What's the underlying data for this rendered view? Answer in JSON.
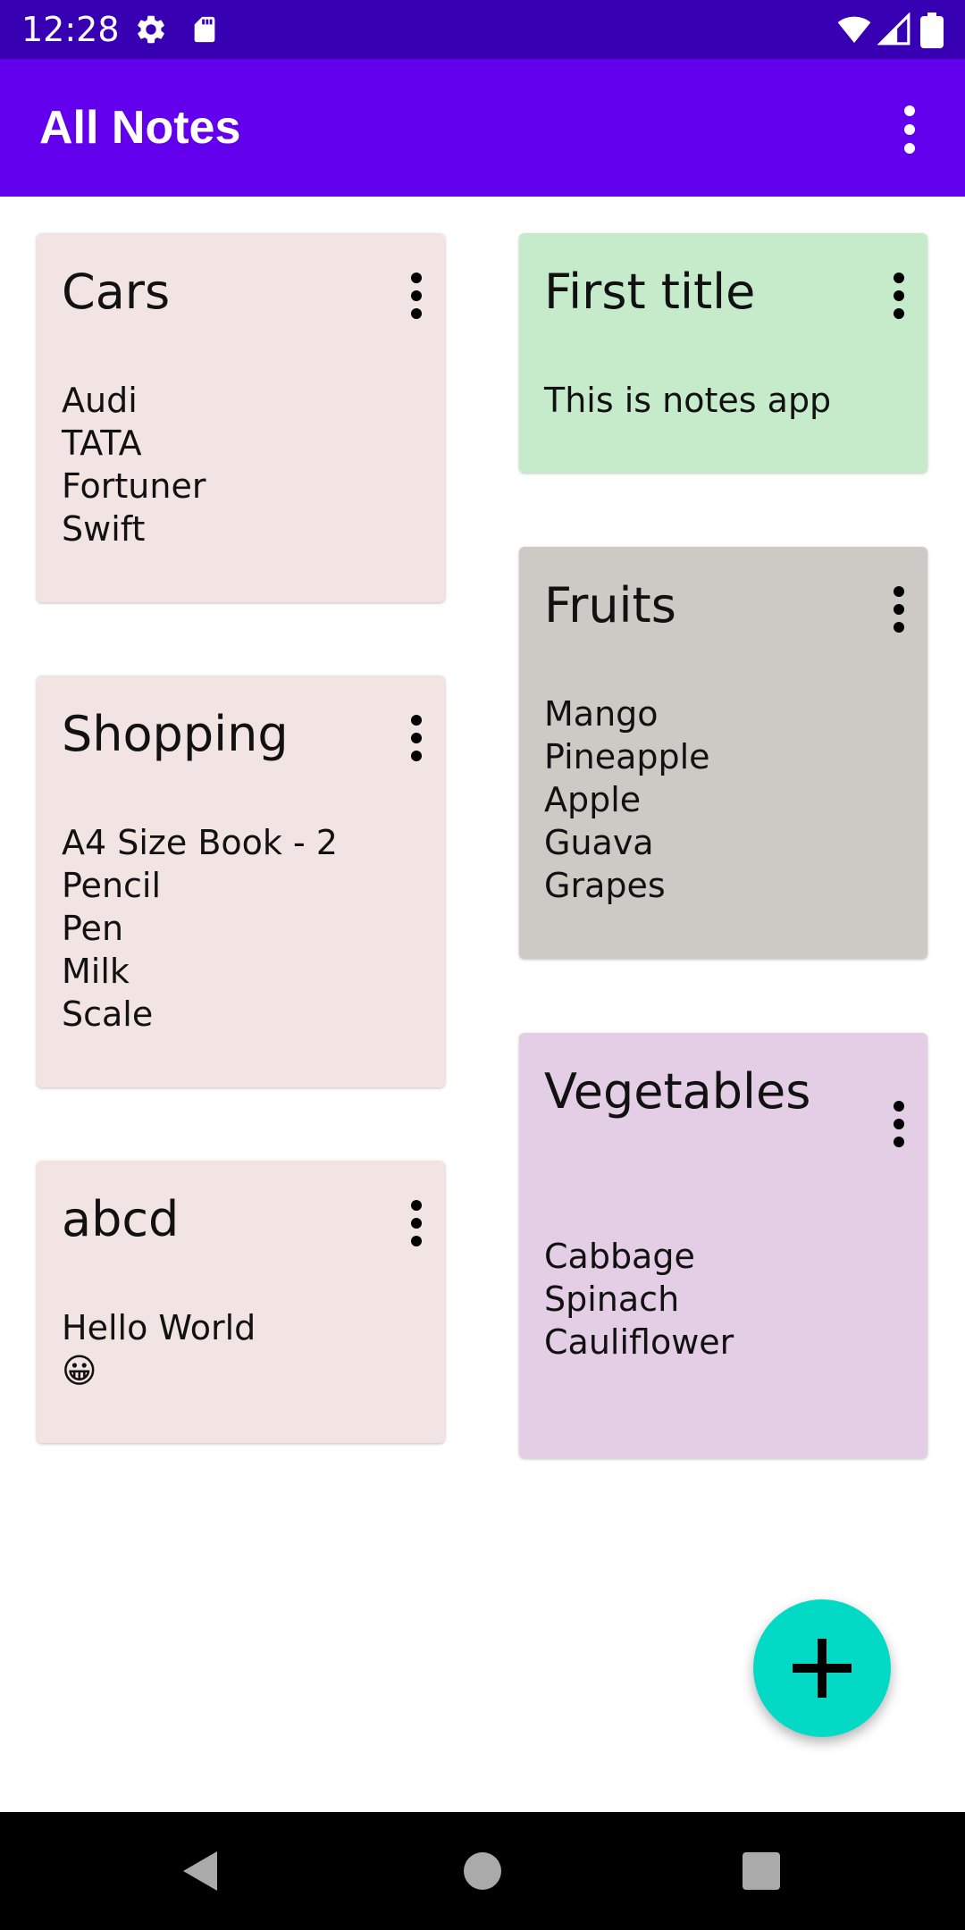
{
  "status_bar": {
    "time": "12:28",
    "icons": [
      "settings-icon",
      "sd-card-icon",
      "wifi-icon",
      "signal-icon",
      "battery-icon"
    ],
    "background": "#3700b3"
  },
  "app_bar": {
    "title": "All Notes",
    "background": "#6200ee",
    "overflow_icon": "more-vert-icon"
  },
  "notes": [
    {
      "title": "Cars",
      "lines": [
        "Audi",
        "TATA",
        "Fortuner",
        "Swift"
      ],
      "color": "#f2e4e2"
    },
    {
      "title": "Shopping",
      "lines": [
        "A4 Size Book - 2",
        "Pencil",
        "Pen",
        "Milk",
        "Scale"
      ],
      "color": "#f2e4e2"
    },
    {
      "title": "abcd",
      "lines": [
        "Hello World",
        "😀"
      ],
      "color": "#f2e4e2"
    },
    {
      "title": "First title",
      "lines": [
        "This is notes app"
      ],
      "color": "#c6ebcb"
    },
    {
      "title": "Fruits",
      "lines": [
        "Mango",
        "Pineapple",
        "Apple",
        "Guava",
        "Grapes"
      ],
      "color": "#cdcac5"
    },
    {
      "title": "Vegetables",
      "lines": [
        "Cabbage",
        "Spinach",
        "Cauliflower"
      ],
      "color": "#e3cee5"
    }
  ],
  "fab": {
    "icon": "add-icon",
    "color": "#03dac5"
  },
  "nav_bar": {
    "icons": [
      "back-icon",
      "home-icon",
      "recents-icon"
    ]
  }
}
